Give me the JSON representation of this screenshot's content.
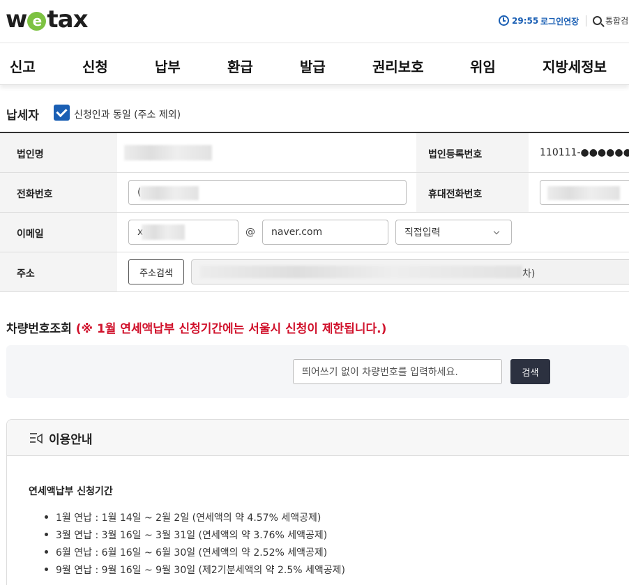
{
  "header": {
    "logo": {
      "pre": "w",
      "mid": "e",
      "post": "tax"
    },
    "timer": "29:55",
    "extend_label": "로그인연장",
    "search_label": "통합검"
  },
  "nav": [
    "신고",
    "신청",
    "납부",
    "환급",
    "발급",
    "권리보호",
    "위임",
    "지방세정보"
  ],
  "taxpayer": {
    "title": "납세자",
    "same_as_applicant": {
      "checked": true,
      "label": "신청인과 동일 (주소 제외)"
    },
    "labels": {
      "corp_name": "법인명",
      "corp_reg_no": "법인등록번호",
      "phone": "전화번호",
      "mobile": "휴대전화번호",
      "email": "이메일",
      "address": "주소"
    },
    "corp_reg_no_value": "110111-●●●●●●",
    "phone_value": "(",
    "email_id": "x",
    "email_at": "@",
    "email_domain": "naver.com",
    "email_select": "직접입력",
    "address_search_button": "주소검색",
    "address_tail": "차)"
  },
  "vehicle": {
    "title": "차량번호조회",
    "warning": "(※ 1월 연세액납부 신청기간에는 서울시 신청이 제한됩니다.)",
    "placeholder": "띄어쓰기 없이 차량번호를 입력하세요.",
    "search_button": "검색"
  },
  "guide": {
    "title": "이용안내",
    "subtitle": "연세액납부 신청기간",
    "items": [
      "1월 연납 : 1월 14일 ~ 2월 2일 (연세액의 약 4.57% 세액공제)",
      "3월 연납 : 3월 16일 ~ 3월 31일 (연세액의 약 3.76% 세액공제)",
      "6월 연납 : 6월 16일 ~ 6월 30일 (연세액의 약 2.52% 세액공제)",
      "9월 연납 : 9월 16일 ~ 9월 30일 (제2기분세액의 약 2.5% 세액공제)"
    ]
  },
  "colors": {
    "brand_blue": "#1a5fb4",
    "warning_red": "#d0112b",
    "logo_green": "#7dc242"
  }
}
